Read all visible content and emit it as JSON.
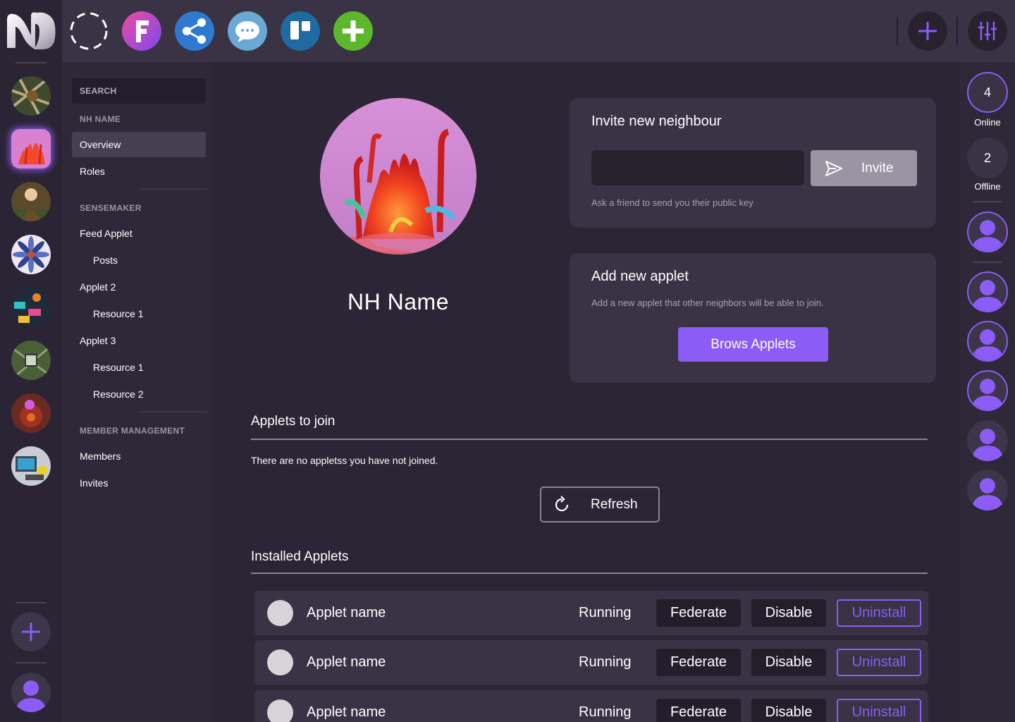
{
  "topbar": {
    "apps": [
      {
        "icon": "placeholder-dashed-circle-icon"
      },
      {
        "icon": "f-app-icon",
        "letter": "F"
      },
      {
        "icon": "share-app-icon"
      },
      {
        "icon": "chat-app-icon"
      },
      {
        "icon": "board-app-icon"
      },
      {
        "icon": "add-app-icon"
      }
    ],
    "add_icon": "plus-icon",
    "settings_icon": "sliders-icon"
  },
  "left_rail": {
    "logo_icon": "nh-logo-icon",
    "neighbourhoods": [
      {
        "name": "nh-1",
        "color": "#4a5a3a"
      },
      {
        "name": "nh-2",
        "color": "#d66fc4",
        "selected": true
      },
      {
        "name": "nh-3",
        "color": "#6b4d2a"
      },
      {
        "name": "nh-4",
        "color": "#7b8fcf"
      },
      {
        "name": "nh-5",
        "color": "#2f8f8f"
      },
      {
        "name": "nh-6",
        "color": "#4f6a3c"
      },
      {
        "name": "nh-7",
        "color": "#8a3a2a"
      },
      {
        "name": "nh-8",
        "color": "#5b6b7a"
      }
    ]
  },
  "sidebar": {
    "search_label": "SEARCH",
    "nh_name_title": "NH NAME",
    "overview": "Overview",
    "roles": "Roles",
    "sensemaker_title": "SENSEMAKER",
    "feed_applet": "Feed Applet",
    "posts": "Posts",
    "applet2": "Applet 2",
    "applet2_resource1": "Resource 1",
    "applet3": "Applet 3",
    "applet3_resource1": "Resource 1",
    "applet3_resource2": "Resource 2",
    "member_mgmt_title": "MEMBER MANAGEMENT",
    "members": "Members",
    "invites": "Invites"
  },
  "right_rail": {
    "online_count": "4",
    "online_label": "Online",
    "offline_count": "2",
    "offline_label": "Offline"
  },
  "main": {
    "nh_name": "NH Name",
    "invite_card": {
      "title": "Invite new neighbour",
      "input_placeholder": "",
      "button": "Invite",
      "note": "Ask a friend to send you their public key"
    },
    "applet_card": {
      "title": "Add new applet",
      "note": "Add a new applet that other neighbors will be able to join.",
      "button": "Brows Applets"
    },
    "applets_to_join": {
      "title": "Applets to join",
      "empty": "There are no appletss you have not joined.",
      "refresh": "Refresh"
    },
    "installed": {
      "title": "Installed Applets",
      "rows": [
        {
          "name": "Applet name",
          "status": "Running",
          "federate": "Federate",
          "disable": "Disable",
          "uninstall": "Uninstall"
        },
        {
          "name": "Applet name",
          "status": "Running",
          "federate": "Federate",
          "disable": "Disable",
          "uninstall": "Uninstall"
        },
        {
          "name": "Applet name",
          "status": "Running",
          "federate": "Federate",
          "disable": "Disable",
          "uninstall": "Uninstall"
        }
      ]
    }
  },
  "colors": {
    "accent": "#8b5cf6",
    "background": "#2b2535",
    "card": "#3a3346"
  }
}
